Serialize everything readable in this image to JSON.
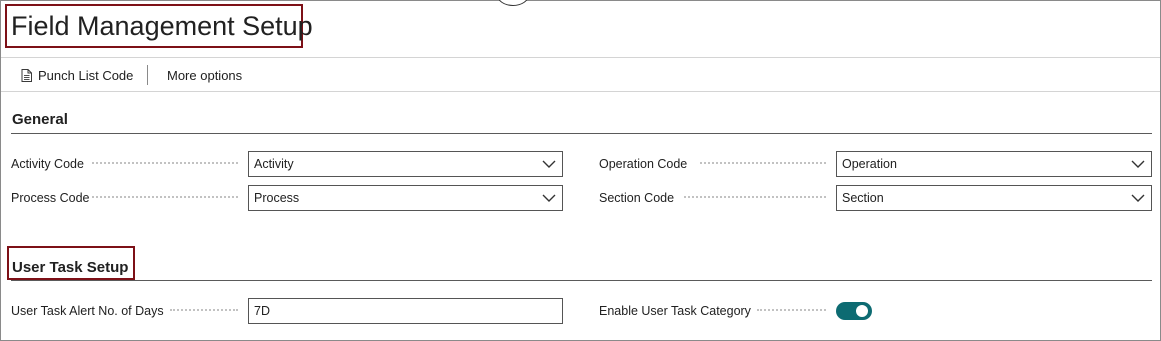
{
  "page": {
    "title": "Field Management Setup"
  },
  "actions": {
    "punch_list_code": "Punch List Code",
    "more_options": "More options"
  },
  "general": {
    "title": "General",
    "fields": {
      "activity_code": {
        "label": "Activity Code",
        "value": "Activity"
      },
      "process_code": {
        "label": "Process Code",
        "value": "Process"
      },
      "operation_code": {
        "label": "Operation Code",
        "value": "Operation"
      },
      "section_code": {
        "label": "Section Code",
        "value": "Section"
      }
    }
  },
  "user_task": {
    "title": "User Task Setup",
    "alert_days": {
      "label": "User Task Alert No. of Days",
      "value": "7D"
    },
    "enable_category": {
      "label": "Enable User Task Category",
      "enabled": true
    }
  },
  "colors": {
    "highlight_border": "#7d1017",
    "toggle_on": "#0d6b72"
  }
}
